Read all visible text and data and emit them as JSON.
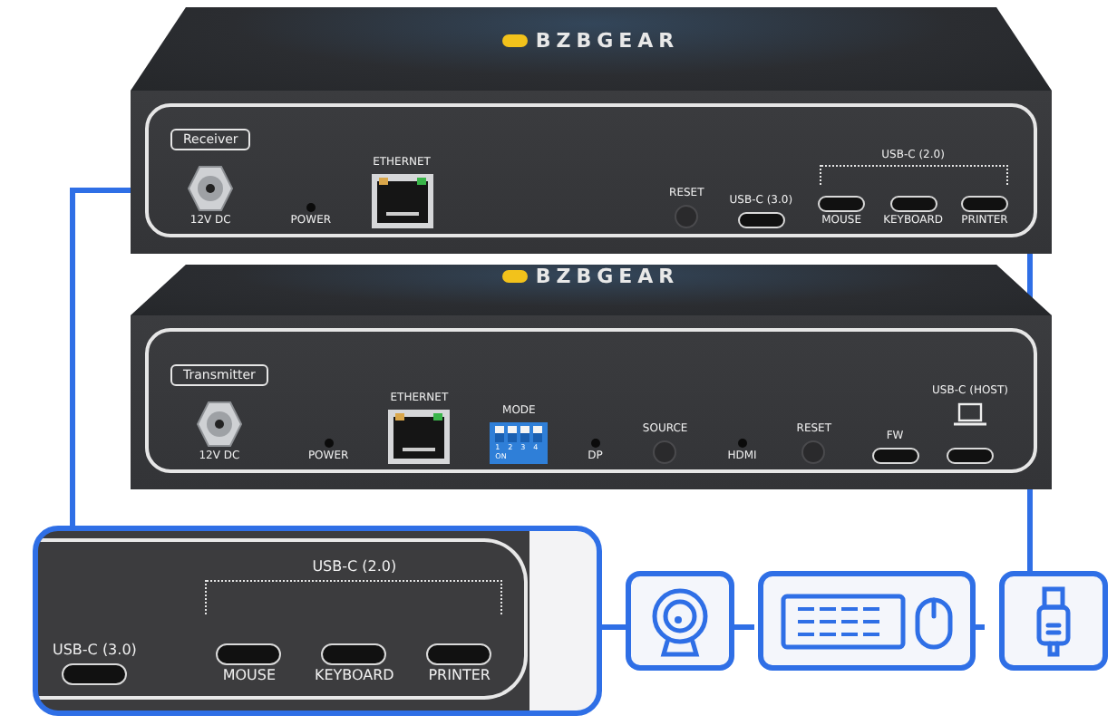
{
  "receiver": {
    "brand": "BZBGEAR",
    "label": "Receiver",
    "ports_left": [
      {
        "kind": "dc",
        "bottom": "12V DC"
      },
      {
        "kind": "led",
        "bottom": "POWER"
      },
      {
        "kind": "ethernet",
        "top": "ETHERNET"
      }
    ],
    "ports_right": [
      {
        "kind": "button",
        "top": "RESET"
      },
      {
        "kind": "usbc",
        "top": "USB-C (3.0)"
      },
      {
        "kind": "group",
        "top": "USB-C (2.0)",
        "ports": [
          {
            "kind": "usbc",
            "bottom": "MOUSE"
          },
          {
            "kind": "usbc",
            "bottom": "KEYBOARD"
          },
          {
            "kind": "usbc",
            "bottom": "PRINTER"
          }
        ]
      }
    ]
  },
  "transmitter": {
    "brand": "BZBGEAR",
    "label": "Transmitter",
    "ports_left": [
      {
        "kind": "dc",
        "bottom": "12V DC"
      },
      {
        "kind": "led",
        "bottom": "POWER"
      },
      {
        "kind": "ethernet",
        "top": "ETHERNET"
      },
      {
        "kind": "dip",
        "top": "MODE",
        "state_label": "ON",
        "switches": [
          {
            "number": "1",
            "on": false
          },
          {
            "number": "2",
            "on": false
          },
          {
            "number": "3",
            "on": false
          },
          {
            "number": "4",
            "on": false
          }
        ]
      },
      {
        "kind": "led",
        "bottom": "DP"
      },
      {
        "kind": "button",
        "top": "SOURCE"
      },
      {
        "kind": "led",
        "bottom": "HDMI"
      },
      {
        "kind": "button",
        "top": "RESET"
      },
      {
        "kind": "usbc",
        "top": "FW"
      }
    ],
    "ports_right": [
      {
        "kind": "host",
        "top": "USB-C (HOST)"
      }
    ]
  },
  "detail": {
    "ports": [
      {
        "kind": "usbc",
        "top": "USB-C (3.0)"
      },
      {
        "kind": "group",
        "top": "USB-C (2.0)",
        "ports": [
          {
            "kind": "usbc",
            "bottom": "MOUSE"
          },
          {
            "kind": "usbc",
            "bottom": "KEYBOARD"
          },
          {
            "kind": "usbc",
            "bottom": "PRINTER"
          }
        ]
      }
    ]
  },
  "peripherals": [
    {
      "kind": "webcam"
    },
    {
      "kind": "keyboard-mouse"
    },
    {
      "kind": "usb-drive"
    }
  ]
}
